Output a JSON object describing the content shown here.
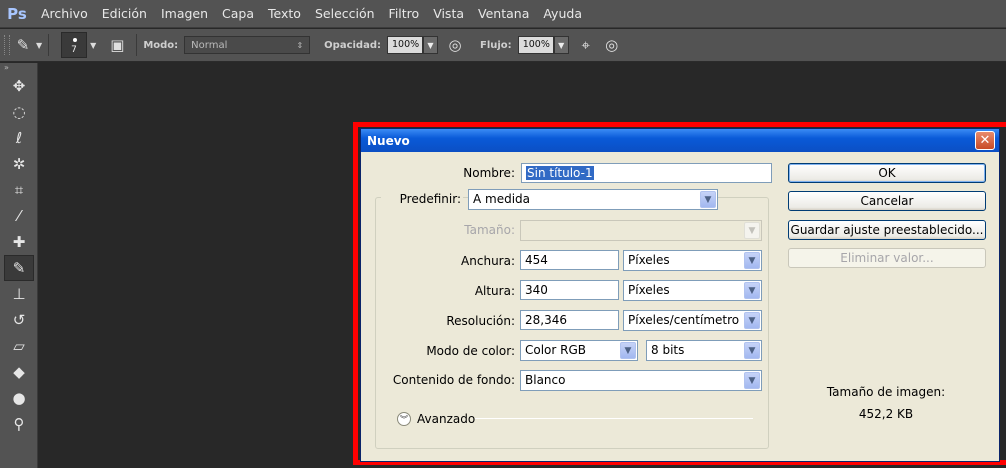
{
  "app": {
    "logo": "Ps",
    "menu": [
      "Archivo",
      "Edición",
      "Imagen",
      "Capa",
      "Texto",
      "Selección",
      "Filtro",
      "Vista",
      "Ventana",
      "Ayuda"
    ]
  },
  "options": {
    "brush_size": "7",
    "mode_label": "Modo:",
    "mode_value": "Normal",
    "opacity_label": "Opacidad:",
    "opacity_value": "100%",
    "flow_label": "Flujo:",
    "flow_value": "100%"
  },
  "tools": [
    "move-tool-icon",
    "marquee-tool-icon",
    "lasso-tool-icon",
    "magic-wand-icon",
    "crop-tool-icon",
    "eyedropper-icon",
    "healing-brush-icon",
    "brush-tool-icon",
    "clone-stamp-icon",
    "history-brush-icon",
    "eraser-icon",
    "paint-bucket-icon",
    "blur-tool-icon",
    "dodge-tool-icon"
  ],
  "dialog": {
    "title": "Nuevo",
    "close": "✕",
    "name_label": "Nombre:",
    "name_value": "Sin título-1",
    "preset_label": "Predefinir:",
    "preset_value": "A medida",
    "size_label": "Tamaño:",
    "size_value": "",
    "width_label": "Anchura:",
    "width_value": "454",
    "width_unit": "Píxeles",
    "height_label": "Altura:",
    "height_value": "340",
    "height_unit": "Píxeles",
    "resolution_label": "Resolución:",
    "resolution_value": "28,346",
    "resolution_unit": "Píxeles/centímetro",
    "color_mode_label": "Modo de color:",
    "color_mode_value": "Color RGB",
    "bit_depth_value": "8 bits",
    "background_label": "Contenido de fondo:",
    "background_value": "Blanco",
    "advanced_label": "Avanzado",
    "ok": "OK",
    "cancel": "Cancelar",
    "save_preset": "Guardar ajuste preestablecido...",
    "delete_preset": "Eliminar valor...",
    "image_size_label": "Tamaño de imagen:",
    "image_size_value": "452,2 KB"
  },
  "colors": {
    "highlight": "#ff0000",
    "titlebar": "#0a5ad8",
    "dialog_bg": "#ece9d8"
  }
}
